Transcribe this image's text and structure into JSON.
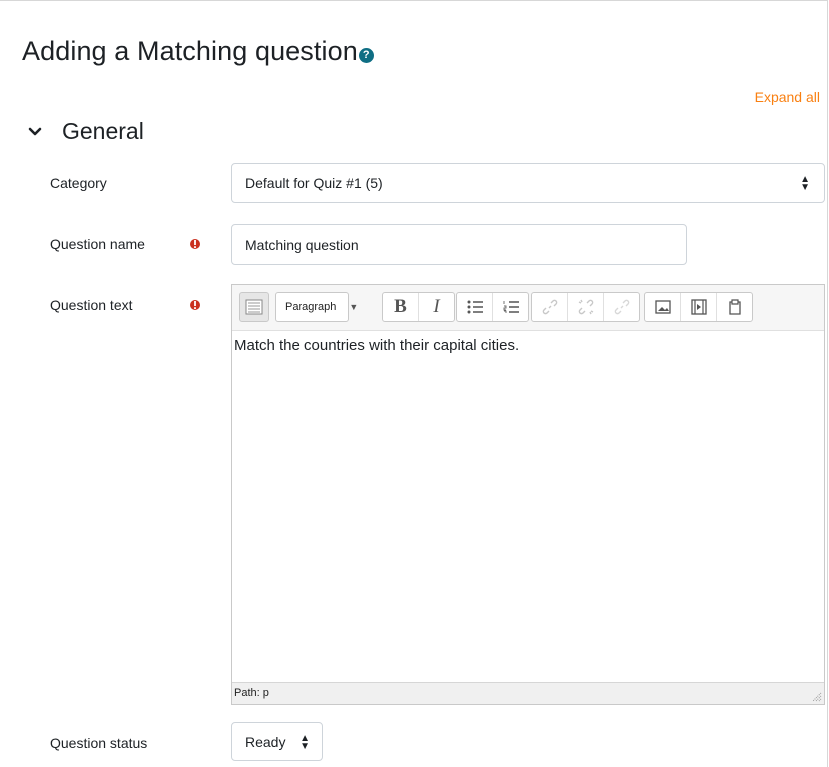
{
  "page": {
    "title": "Adding a Matching question",
    "expand_all": "Expand all"
  },
  "section": {
    "title": "General"
  },
  "fields": {
    "category": {
      "label": "Category",
      "value": "Default for Quiz #1 (5)"
    },
    "question_name": {
      "label": "Question name",
      "value": "Matching question"
    },
    "question_text": {
      "label": "Question text",
      "content": "Match the countries with their capital cities.",
      "format_select": "Paragraph",
      "path": "Path: p"
    },
    "question_status": {
      "label": "Question status",
      "value": "Ready"
    }
  },
  "toolbar": {
    "bold": "B",
    "italic": "I",
    "icons": [
      "toolbar-toggle-icon",
      "bold-icon",
      "italic-icon",
      "unordered-list-icon",
      "ordered-list-icon",
      "link-icon",
      "unlink-icon",
      "anchor-icon",
      "image-icon",
      "media-icon",
      "manage-files-icon"
    ]
  },
  "colors": {
    "accent": "#f98012",
    "required": "#ca3120",
    "help": "#0f6e84"
  }
}
